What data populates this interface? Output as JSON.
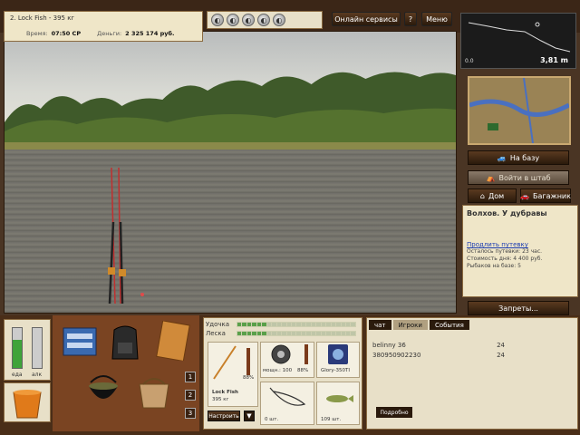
{
  "status": {
    "fish_line": "2. Lock Fish - 395 кг",
    "time_label": "Время:",
    "time_value": "07:50 СР",
    "money_label": "Деньги:",
    "money_value": "2 325 174 руб."
  },
  "top_menu": {
    "online_label": "Онлайн сервисы",
    "help_label": "?",
    "menu_label": "Меню"
  },
  "depth": {
    "value": "3,81 m",
    "battery": "0.0"
  },
  "nav": {
    "base_label": "На базу",
    "hq_label": "Войти в штаб",
    "home_label": "Дом",
    "car_label": "Багажник",
    "bans_label": "Запреты..."
  },
  "location": {
    "title": "Волхов. У дубравы",
    "extend_link": "Продлить путевку",
    "remaining": "Осталось путевки: 23 час.",
    "day_cost": "Стоимость дня: 4 400 руб.",
    "fishers": "Рыбаков на базе: 5"
  },
  "meters": {
    "left_label": "еда",
    "right_label": "алк",
    "left_level": 0.7,
    "right_level": 0.0
  },
  "slots": [
    "1",
    "2",
    "3"
  ],
  "tackle": {
    "rod_status_label": "Удочка",
    "line_status_label": "Леска",
    "rod_name": "Lock Fish",
    "rod_weight": "395 кг",
    "rod_percent": "88%",
    "reel_power": "мощн.: 100",
    "reel_percent": "88%",
    "line_name": "Glory-350TI",
    "hook_count": "0 шт.",
    "bait_count": "109 шт.",
    "tune_label": "Настроить",
    "tune_arrow": "▼"
  },
  "chat": {
    "tabs": [
      "чат",
      "Игроки",
      "События"
    ],
    "rows": [
      {
        "name": "belinny 36",
        "score": "24"
      },
      {
        "name": "380950902230",
        "score": "24"
      }
    ],
    "more_label": "Подробно"
  },
  "colors": {
    "meter_fill": "#3fa33a",
    "panel": "#e8e0c8",
    "button_dark": "#2a1a0c"
  }
}
